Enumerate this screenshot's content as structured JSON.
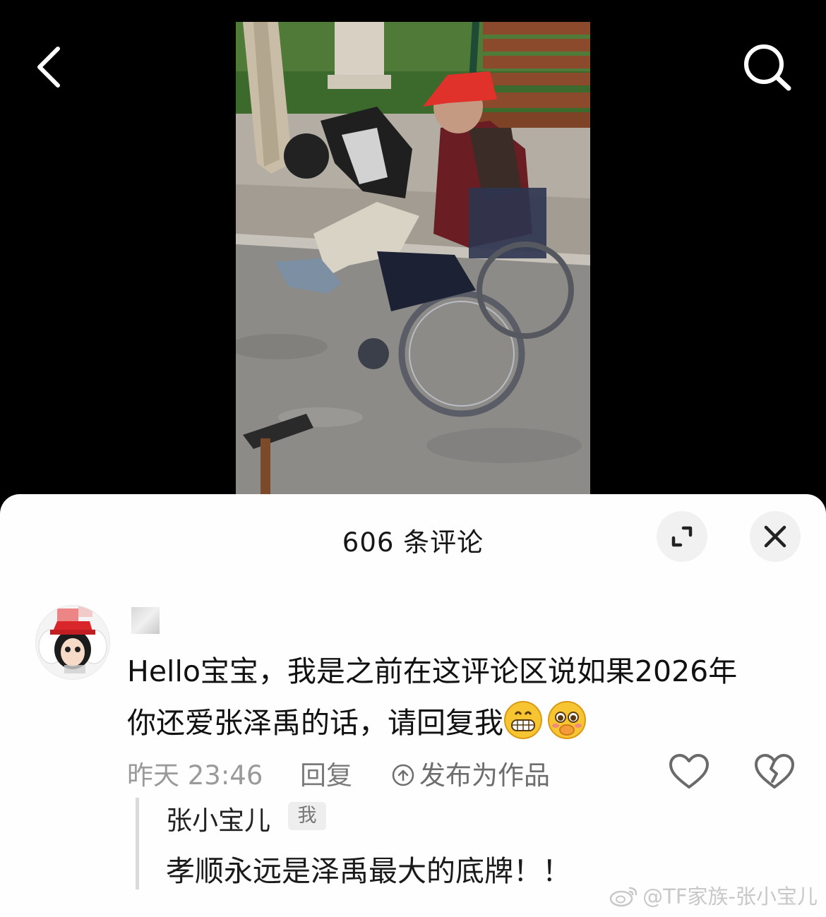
{
  "header": {
    "back_icon": "chevron-left-icon",
    "search_icon": "search-icon"
  },
  "comments_panel": {
    "title": "606 条评论",
    "expand_icon": "expand-icon",
    "close_icon": "close-icon"
  },
  "comment": {
    "text_line1": "Hello宝宝，我是之前在这评论区说如果2026年",
    "text_line2": "你还爱张泽禹的话，请回复我",
    "emojis": [
      "grin-emoji",
      "pleading-emoji"
    ],
    "time": "昨天 23:46",
    "reply_label": "回复",
    "publish_label": "发布为作品",
    "like_icon": "heart-icon",
    "dislike_icon": "broken-heart-icon"
  },
  "reply": {
    "author": "张小宝儿",
    "badge": "我",
    "text": "孝顺永远是泽禹最大的底牌！！"
  },
  "watermark": {
    "text": "@TF家族-张小宝儿"
  },
  "colors": {
    "background": "#000000",
    "sheet": "#fefefe",
    "secondary_text": "#9a9a9a",
    "button_bg": "#f1f1f1"
  }
}
